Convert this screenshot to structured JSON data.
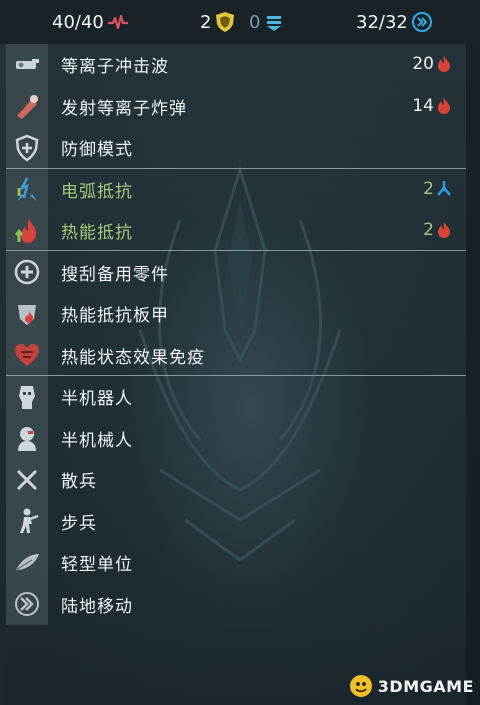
{
  "header": {
    "hp": "40/40",
    "shield": "2",
    "armor": "0",
    "movement": "32/32"
  },
  "abilities": [
    {
      "label": "等离子冲击波",
      "value": "20",
      "icon": "plasma-gun-icon",
      "value_icon": "fire-icon"
    },
    {
      "label": "发射等离子炸弹",
      "value": "14",
      "icon": "plasma-bomb-icon",
      "value_icon": "fire-icon"
    },
    {
      "label": "防御模式",
      "value": "",
      "icon": "defense-shield-icon",
      "value_icon": ""
    }
  ],
  "resistances": [
    {
      "label": "电弧抵抗",
      "value": "2",
      "icon": "arc-resist-icon",
      "value_icon": "arc-icon"
    },
    {
      "label": "热能抵抗",
      "value": "2",
      "icon": "thermal-resist-icon",
      "value_icon": "fire-icon"
    }
  ],
  "passives": [
    {
      "label": "搜刮备用零件",
      "icon": "salvage-plus-icon"
    },
    {
      "label": "热能抵抗板甲",
      "icon": "thermal-plate-icon"
    },
    {
      "label": "热能状态效果免疫",
      "icon": "heart-immune-icon"
    }
  ],
  "traits": [
    {
      "label": "半机器人",
      "icon": "cyborg-icon"
    },
    {
      "label": "半机械人",
      "icon": "mechanical-human-icon"
    },
    {
      "label": "散兵",
      "icon": "skirmisher-icon"
    },
    {
      "label": "步兵",
      "icon": "infantry-icon"
    },
    {
      "label": "轻型单位",
      "icon": "feather-icon"
    },
    {
      "label": "陆地移动",
      "icon": "land-move-icon"
    }
  ],
  "watermark": "3DMGAME",
  "colors": {
    "resist_text": "#a9c77c",
    "fire": "#d9443a",
    "arc": "#2a9bd6",
    "shield": "#e3c53b"
  }
}
